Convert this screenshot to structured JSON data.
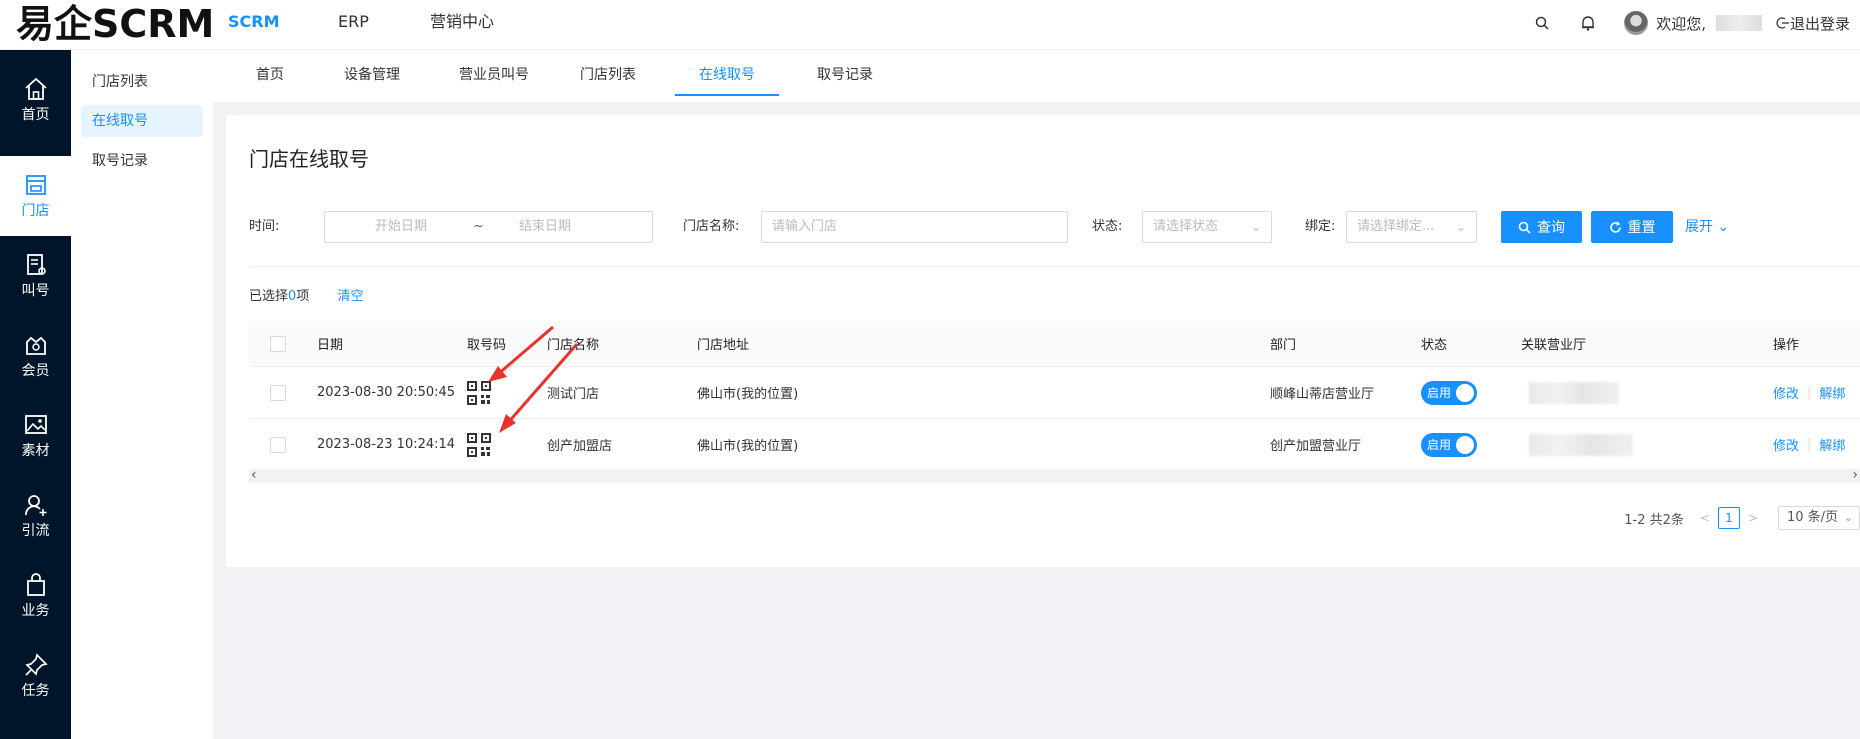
{
  "header": {
    "logo": "易企SCRM",
    "nav": [
      {
        "label": "SCRM",
        "active": true
      },
      {
        "label": "ERP",
        "active": false
      },
      {
        "label": "营销中心",
        "active": false
      }
    ],
    "welcome": "欢迎您,",
    "logout": "退出登录"
  },
  "rail": [
    {
      "label": "首页",
      "icon": "home-icon",
      "active": false
    },
    {
      "label": "门店",
      "icon": "store-icon",
      "active": true
    },
    {
      "label": "叫号",
      "icon": "call-number-icon",
      "active": false
    },
    {
      "label": "会员",
      "icon": "member-icon",
      "active": false
    },
    {
      "label": "素材",
      "icon": "image-icon",
      "active": false
    },
    {
      "label": "引流",
      "icon": "user-add-icon",
      "active": false
    },
    {
      "label": "业务",
      "icon": "bag-icon",
      "active": false
    },
    {
      "label": "任务",
      "icon": "pin-icon",
      "active": false
    }
  ],
  "submenu": [
    {
      "label": "门店列表",
      "active": false
    },
    {
      "label": "在线取号",
      "active": true
    },
    {
      "label": "取号记录",
      "active": false
    }
  ],
  "tabs": [
    {
      "label": "首页",
      "active": false
    },
    {
      "label": "设备管理",
      "active": false
    },
    {
      "label": "营业员叫号",
      "active": false
    },
    {
      "label": "门店列表",
      "active": false
    },
    {
      "label": "在线取号",
      "active": true
    },
    {
      "label": "取号记录",
      "active": false
    }
  ],
  "page": {
    "title": "门店在线取号"
  },
  "filters": {
    "time_label": "时间:",
    "start_placeholder": "开始日期",
    "range_sep": "~",
    "end_placeholder": "结束日期",
    "store_label": "门店名称:",
    "store_placeholder": "请输入门店",
    "status_label": "状态:",
    "status_placeholder": "请选择状态",
    "bind_label": "绑定:",
    "bind_placeholder": "请选择绑定...",
    "search_button": "查询",
    "reset_button": "重置",
    "expand": "展开"
  },
  "selection": {
    "prefix": "已选择",
    "count": "0",
    "suffix": "项",
    "clear": "清空"
  },
  "table": {
    "columns": [
      "日期",
      "取号码",
      "门店名称",
      "门店地址",
      "部门",
      "状态",
      "关联营业厅",
      "操作"
    ],
    "rows": [
      {
        "date": "2023-08-30 20:50:45",
        "store": "测试门店",
        "address": "佛山市(我的位置)",
        "dept": "顺峰山蒂店营业厅",
        "status": "启用",
        "edit": "修改",
        "unbind": "解绑"
      },
      {
        "date": "2023-08-23 10:24:14",
        "store": "创产加盟店",
        "address": "佛山市(我的位置)",
        "dept": "创产加盟营业厅",
        "status": "启用",
        "edit": "修改",
        "unbind": "解绑"
      }
    ]
  },
  "pagination": {
    "summary": "1-2 共2条",
    "current": "1",
    "page_size": "10 条/页"
  },
  "colors": {
    "accent": "#1890ff",
    "rail_bg": "#001529",
    "annotation_arrow": "#e8322b"
  }
}
